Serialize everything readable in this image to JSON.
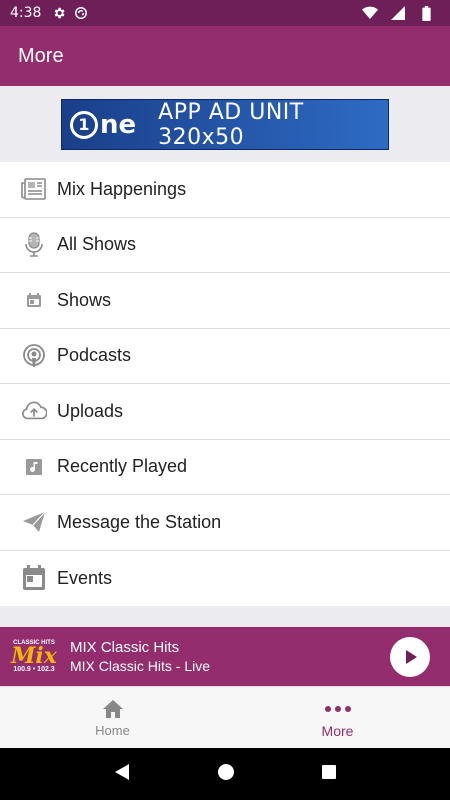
{
  "status_bar": {
    "time": "4:38"
  },
  "app_bar": {
    "title": "More"
  },
  "ad": {
    "brand": "ne",
    "text": "APP AD UNIT 320x50"
  },
  "menu": [
    {
      "label": "Mix Happenings",
      "icon": "newspaper-icon"
    },
    {
      "label": "All Shows",
      "icon": "microphone-icon"
    },
    {
      "label": "Shows",
      "icon": "calendar-small-icon"
    },
    {
      "label": "Podcasts",
      "icon": "podcast-icon"
    },
    {
      "label": "Uploads",
      "icon": "cloud-upload-icon"
    },
    {
      "label": "Recently Played",
      "icon": "music-note-icon"
    },
    {
      "label": "Message the Station",
      "icon": "send-icon"
    },
    {
      "label": "Events",
      "icon": "calendar-icon"
    }
  ],
  "now_playing": {
    "logo_top": "CLASSIC HITS",
    "logo_mix": "Mix",
    "logo_freq": "100.9 • 102.3",
    "title": "MIX Classic Hits",
    "subtitle": "MIX Classic Hits - Live"
  },
  "bottom_nav": {
    "home_label": "Home",
    "more_label": "More"
  },
  "colors": {
    "primary": "#942d6e",
    "status_bar": "#6e1f57",
    "accent_logo": "#f5b800"
  }
}
